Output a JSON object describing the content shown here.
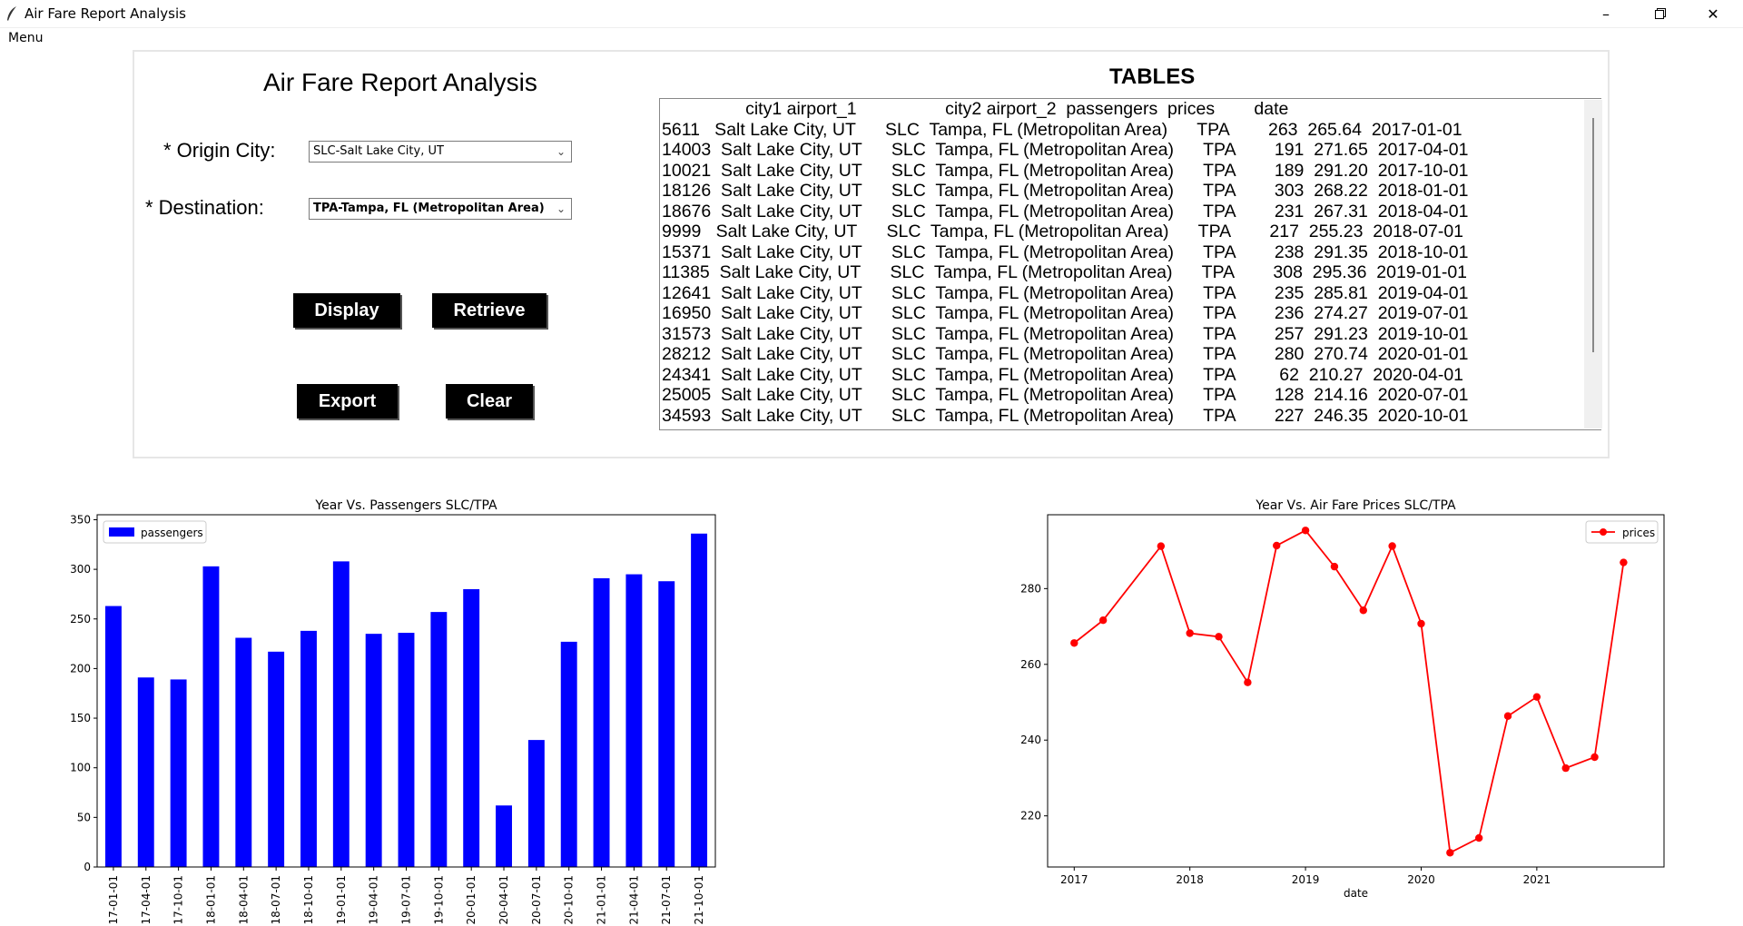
{
  "window": {
    "title": "Air Fare Report Analysis",
    "menu_label": "Menu"
  },
  "form": {
    "heading": "Air Fare Report Analysis",
    "origin_label": "* Origin City:",
    "origin_value": "SLC-Salt Lake City, UT",
    "destination_label": "* Destination:",
    "destination_value": "TPA-Tampa, FL (Metropolitan Area)",
    "buttons": {
      "display": "Display",
      "retrieve": "Retrieve",
      "export": "Export",
      "clear": "Clear"
    }
  },
  "tables": {
    "heading": "TABLES",
    "text": "                 city1 airport_1                  city2 airport_2  passengers  prices        date\n5611   Salt Lake City, UT      SLC  Tampa, FL (Metropolitan Area)      TPA        263  265.64  2017-01-01\n14003  Salt Lake City, UT      SLC  Tampa, FL (Metropolitan Area)      TPA        191  271.65  2017-04-01\n10021  Salt Lake City, UT      SLC  Tampa, FL (Metropolitan Area)      TPA        189  291.20  2017-10-01\n18126  Salt Lake City, UT      SLC  Tampa, FL (Metropolitan Area)      TPA        303  268.22  2018-01-01\n18676  Salt Lake City, UT      SLC  Tampa, FL (Metropolitan Area)      TPA        231  267.31  2018-04-01\n9999   Salt Lake City, UT      SLC  Tampa, FL (Metropolitan Area)      TPA        217  255.23  2018-07-01\n15371  Salt Lake City, UT      SLC  Tampa, FL (Metropolitan Area)      TPA        238  291.35  2018-10-01\n11385  Salt Lake City, UT      SLC  Tampa, FL (Metropolitan Area)      TPA        308  295.36  2019-01-01\n12641  Salt Lake City, UT      SLC  Tampa, FL (Metropolitan Area)      TPA        235  285.81  2019-04-01\n16950  Salt Lake City, UT      SLC  Tampa, FL (Metropolitan Area)      TPA        236  274.27  2019-07-01\n31573  Salt Lake City, UT      SLC  Tampa, FL (Metropolitan Area)      TPA        257  291.23  2019-10-01\n28212  Salt Lake City, UT      SLC  Tampa, FL (Metropolitan Area)      TPA        280  270.74  2020-01-01\n24341  Salt Lake City, UT      SLC  Tampa, FL (Metropolitan Area)      TPA         62  210.27  2020-04-01\n25005  Salt Lake City, UT      SLC  Tampa, FL (Metropolitan Area)      TPA        128  214.16  2020-07-01\n34593  Salt Lake City, UT      SLC  Tampa, FL (Metropolitan Area)      TPA        227  246.35  2020-10-01"
  },
  "chart_data": [
    {
      "type": "bar",
      "title": "Year Vs. Passengers   SLC/TPA",
      "categories": [
        "2017-01-01",
        "2017-04-01",
        "2017-10-01",
        "2018-01-01",
        "2018-04-01",
        "2018-07-01",
        "2018-10-01",
        "2019-01-01",
        "2019-04-01",
        "2019-07-01",
        "2019-10-01",
        "2020-01-01",
        "2020-04-01",
        "2020-07-01",
        "2020-10-01",
        "2021-01-01",
        "2021-04-01",
        "2021-07-01",
        "2021-10-01"
      ],
      "series": [
        {
          "name": "passengers",
          "color": "#0000ff",
          "values": [
            263,
            191,
            189,
            303,
            231,
            217,
            238,
            308,
            235,
            236,
            257,
            280,
            62,
            128,
            227,
            291,
            295,
            288,
            336
          ]
        }
      ],
      "ylim": [
        0,
        355
      ],
      "yticks": [
        0,
        50,
        100,
        150,
        200,
        250,
        300,
        350
      ],
      "legend": "top-left"
    },
    {
      "type": "line",
      "title": "Year Vs. Air Fare Prices   SLC/TPA",
      "xlabel": "date",
      "x": [
        "2017-01-01",
        "2017-04-01",
        "2017-10-01",
        "2018-01-01",
        "2018-04-01",
        "2018-07-01",
        "2018-10-01",
        "2019-01-01",
        "2019-04-01",
        "2019-07-01",
        "2019-10-01",
        "2020-01-01",
        "2020-04-01",
        "2020-07-01",
        "2020-10-01",
        "2021-01-01",
        "2021-04-01",
        "2021-07-01",
        "2021-10-01"
      ],
      "series": [
        {
          "name": "prices",
          "color": "#ff0000",
          "values": [
            265.64,
            271.65,
            291.2,
            268.22,
            267.31,
            255.23,
            291.35,
            295.36,
            285.81,
            274.27,
            291.23,
            270.74,
            210.27,
            214.16,
            246.35,
            251.4,
            232.6,
            235.5,
            286.9
          ]
        }
      ],
      "ylim": [
        206.5,
        299.5
      ],
      "yticks": [
        220,
        240,
        260,
        280
      ],
      "xticks": [
        "2017",
        "2018",
        "2019",
        "2020",
        "2021"
      ],
      "legend": "top-right"
    }
  ]
}
